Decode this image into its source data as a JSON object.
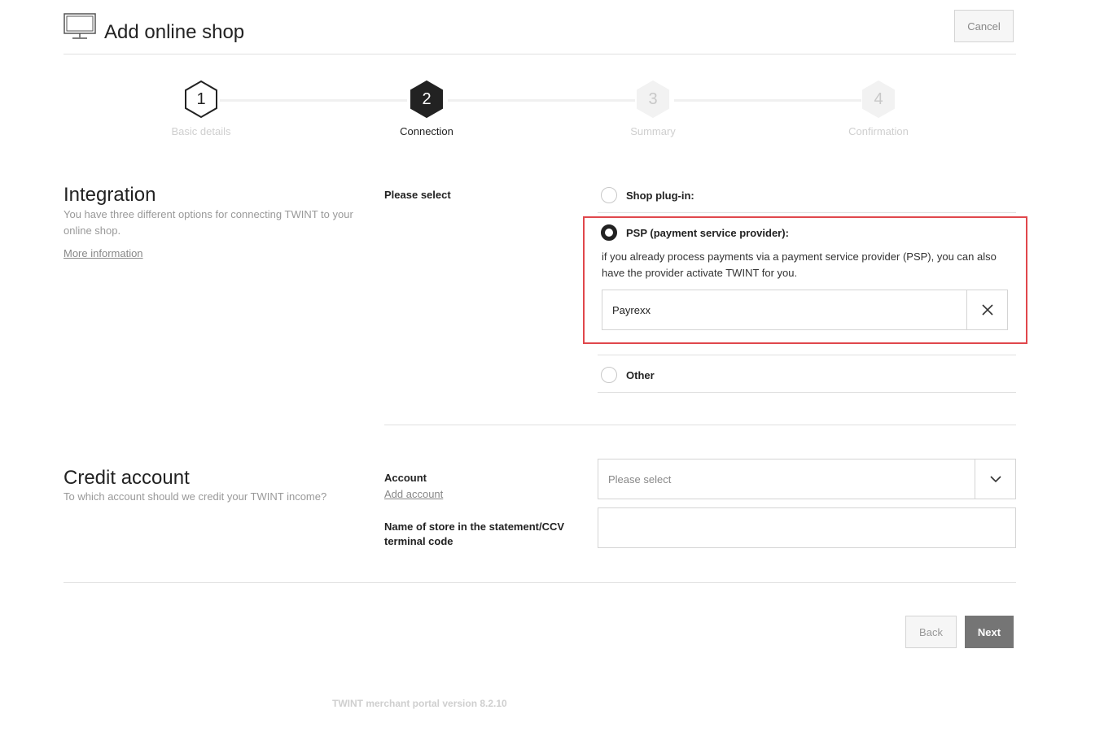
{
  "header": {
    "title": "Add online shop",
    "icon": "monitor-icon",
    "cancel_label": "Cancel"
  },
  "stepper": {
    "current_step": 2,
    "steps": [
      {
        "number": "1",
        "label": "Basic details",
        "state": "done"
      },
      {
        "number": "2",
        "label": "Connection",
        "state": "active"
      },
      {
        "number": "3",
        "label": "Summary",
        "state": "upcoming"
      },
      {
        "number": "4",
        "label": "Confirmation",
        "state": "upcoming"
      }
    ]
  },
  "integration": {
    "title": "Integration",
    "description": "You have three different options for connecting TWINT to your online shop.",
    "more_info_link": "More information",
    "select_label": "Please select",
    "options": [
      {
        "label": "Shop plug-in:",
        "selected": false
      },
      {
        "label": "PSP (payment service provider):",
        "selected": true
      },
      {
        "label": "Other",
        "selected": false
      }
    ],
    "psp_description": "if you already process payments via a payment service provider (PSP), you can also have the provider activate TWINT for you.",
    "psp_value": "Payrexx",
    "highlight_color": "#e0474c"
  },
  "credit_account": {
    "title": "Credit account",
    "description": "To which account should we credit your TWINT income?",
    "account_label": "Account",
    "add_account_link": "Add account",
    "account_placeholder": "Please select",
    "store_name_label": "Name of store in the statement/CCV terminal code",
    "store_name_value": ""
  },
  "actions": {
    "back_label": "Back",
    "next_label": "Next"
  },
  "footer": {
    "version_text": "TWINT merchant portal version 8.2.10"
  },
  "colors": {
    "active_step": "#222222",
    "upcoming_step": "#f2f2f2",
    "next_button": "#757575"
  }
}
